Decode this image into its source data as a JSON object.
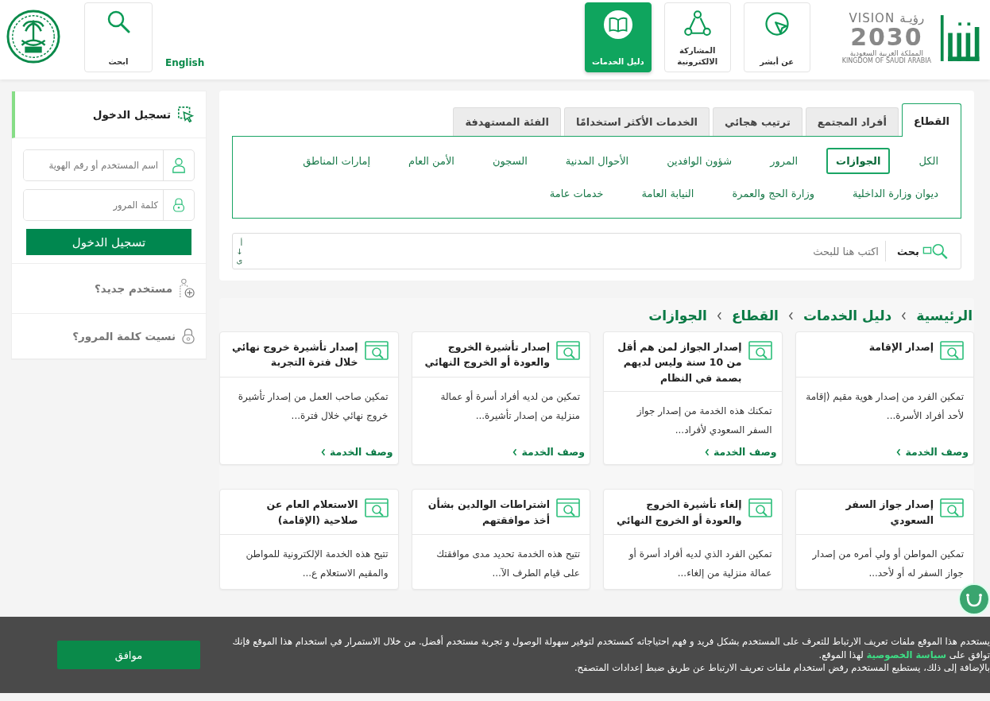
{
  "header": {
    "vision_logo": {
      "word_en": "VISION",
      "word_ar": "رؤيـة",
      "year": "2030",
      "country_ar": "المملكة العربية السعودية",
      "country_en": "KINGDOM OF SAUDI ARABIA"
    },
    "nav": [
      {
        "label": "عن أبشر",
        "selected": false
      },
      {
        "label": "المشاركة الالكترونية",
        "selected": false
      },
      {
        "label": "دليل الخدمات",
        "selected": true
      }
    ],
    "language": "English",
    "search_button": "ابحث"
  },
  "tabs": [
    {
      "label": "القطاع",
      "selected": true
    },
    {
      "label": "أفراد المجتمع",
      "selected": false
    },
    {
      "label": "ترتيب هجائي",
      "selected": false
    },
    {
      "label": "الخدمات الأكثر استخدامًا",
      "selected": false
    },
    {
      "label": "الفئة المستهدفة",
      "selected": false
    }
  ],
  "sectors": [
    {
      "label": "الكل",
      "selected": false
    },
    {
      "label": "الجوازات",
      "selected": true
    },
    {
      "label": "المرور",
      "selected": false
    },
    {
      "label": "شؤون الوافدين",
      "selected": false
    },
    {
      "label": "الأحوال المدنية",
      "selected": false
    },
    {
      "label": "السجون",
      "selected": false
    },
    {
      "label": "الأمن العام",
      "selected": false
    },
    {
      "label": "إمارات المناطق",
      "selected": false
    },
    {
      "label": "ديوان وزارة الداخلية",
      "selected": false
    },
    {
      "label": "وزارة الحج والعمرة",
      "selected": false
    },
    {
      "label": "النيابة العامة",
      "selected": false
    },
    {
      "label": "خدمات عامة",
      "selected": false
    }
  ],
  "search": {
    "label": "بحث",
    "placeholder": "اكتب هنا للبحث",
    "sort_toggle": [
      "أ",
      "↓",
      "ى"
    ]
  },
  "breadcrumb": [
    "الرئيسية",
    "دليل الخدمات",
    "القطاع",
    "الجوازات"
  ],
  "cards": [
    {
      "title": "إصدار الإقامة",
      "description": "تمكين الفرد من إصدار هوية مقيم (إقامة لأحد أفراد الأسرة...",
      "link": "وصف الخدمة"
    },
    {
      "title": "إصدار الجواز لمن هم أقل من 10 سنة وليس لديهم بصمة في النظام",
      "description": "تمكنك هذه الخدمة من إصدار جواز السفر السعودي لأفراد...",
      "link": "وصف الخدمة"
    },
    {
      "title": "إصدار تأشيرة الخروج والعودة أو الخروج النهائي",
      "description": "تمكين من لديه أفراد أسرة أو عمالة منزلية من إصدار تأشيرة...",
      "link": "وصف الخدمة"
    },
    {
      "title": "إصدار تأشيرة خروج نهائي خلال فترة التجربة",
      "description": "تمكين صاحب العمل من إصدار تأشيرة خروج نهائي خلال فترة...",
      "link": "وصف الخدمة"
    },
    {
      "title": "إصدار جواز السفر السعودي",
      "description": "تمكين المواطن أو ولي أمره من إصدار جواز السفر له أو لأحد..."
    },
    {
      "title": "إلغاء تأشيرة الخروج والعودة أو الخروج النهائي",
      "description": "تمكين الفرد الذي لديه أفراد أسرة أو عمالة منزلية من إلغاء..."
    },
    {
      "title": "اشتراطات الوالدين بشأن أخذ موافقتهم",
      "description": "تتيح هذه الخدمة تحديد مدى موافقتك على قيام الطرف الآ..."
    },
    {
      "title": "الاستعلام العام عن صلاحية (الإقامة)",
      "description": "تتيح هذه الخدمة الإلكترونية للمواطن والمقيم الاستعلام ع..."
    }
  ],
  "login": {
    "title": "تسجيل الدخول",
    "username_placeholder": "اسم المستخدم أو رقم الهوية",
    "password_placeholder": "كلمة المرور",
    "button": "تسجيل الدخول",
    "new_user": "مستخدم جديد؟",
    "forgot_password": "نسيت كلمة المرور؟"
  },
  "cookie_banner": {
    "text_before": "يستخدم هذا الموقع ملفات تعريف الارتباط للتعرف على المستخدم بشكل فريد و فهم احتياجاته كمستخدم لتوفير سهولة الوصول و تجربة مستخدم أفضل. من خلال الاستمرار في استخدام هذا الموقع فإنك توافق على",
    "link": "سياسة الخصوصية",
    "text_after": "لهذا الموقع.",
    "note": "بالإضافة إلى ذلك، يستطيع المستخدم رفض استخدام ملفات تعريف الارتباط عن طريق ضبط إعدادات المتصفح.",
    "button": "موافق"
  }
}
